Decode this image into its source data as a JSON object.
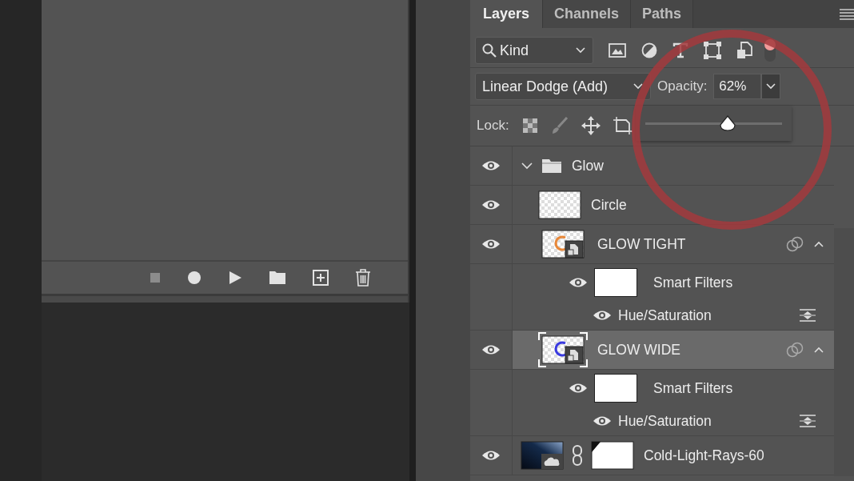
{
  "actions_panel": {
    "buttons": [
      {
        "kind": "stop",
        "disabled": true
      },
      {
        "kind": "record",
        "disabled": false
      },
      {
        "kind": "play",
        "disabled": false
      },
      {
        "kind": "folder",
        "disabled": false
      },
      {
        "kind": "new",
        "disabled": false
      },
      {
        "kind": "delete",
        "disabled": false
      }
    ]
  },
  "layers_panel": {
    "tabs": [
      {
        "label": "Layers",
        "selected": true
      },
      {
        "label": "Channels",
        "selected": false
      },
      {
        "label": "Paths",
        "selected": false
      }
    ],
    "filter": {
      "value": "Kind",
      "toggle_on": true
    },
    "blend_mode": {
      "value": "Linear Dodge (Add)"
    },
    "opacity": {
      "label": "Opacity:",
      "value": "62%",
      "level": 0.6
    },
    "lock": {
      "label": "Lock:"
    },
    "items": [
      {
        "kind": "group",
        "name": "Glow",
        "visible": true,
        "selected": false,
        "expanded": true,
        "children": [
          {
            "kind": "pixel",
            "name": "Circle",
            "visible": true,
            "selected": false
          },
          {
            "kind": "smart",
            "name": "GLOW TIGHT",
            "visible": true,
            "selected": false,
            "expanded": true,
            "color": "#e8883a",
            "filters_label": "Smart Filters",
            "filters_visible": true,
            "filters": [
              {
                "name": "Hue/Saturation",
                "visible": true
              }
            ]
          },
          {
            "kind": "smart",
            "name": "GLOW WIDE",
            "visible": true,
            "selected": true,
            "expanded": true,
            "color": "#3a3ae0",
            "filters_label": "Smart Filters",
            "filters_visible": true,
            "filters": [
              {
                "name": "Hue/Saturation",
                "visible": true
              }
            ]
          }
        ]
      },
      {
        "kind": "masked",
        "name": "Cold-Light-Rays-60",
        "visible": true,
        "selected": false
      }
    ]
  }
}
